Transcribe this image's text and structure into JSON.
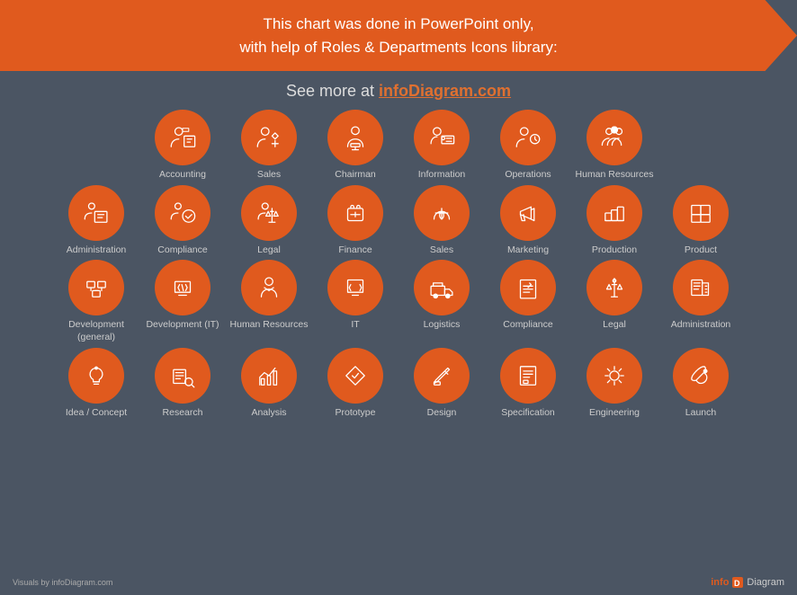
{
  "banner": {
    "line1": "This chart was done in PowerPoint only,",
    "line2": "with help of Roles & Departments Icons library:"
  },
  "see_more": {
    "prefix": "See more at ",
    "link_text": "infoDiagram.com"
  },
  "rows": [
    {
      "items": [
        {
          "label": "Accounting",
          "icon": "accounting"
        },
        {
          "label": "Sales",
          "icon": "sales"
        },
        {
          "label": "Chairman",
          "icon": "chairman"
        },
        {
          "label": "Information",
          "icon": "information"
        },
        {
          "label": "Operations",
          "icon": "operations"
        },
        {
          "label": "Human\nResources",
          "icon": "human_resources"
        }
      ]
    },
    {
      "items": [
        {
          "label": "Administration",
          "icon": "administration"
        },
        {
          "label": "Compliance",
          "icon": "compliance"
        },
        {
          "label": "Legal",
          "icon": "legal"
        },
        {
          "label": "Finance",
          "icon": "finance"
        },
        {
          "label": "Sales",
          "icon": "sales2"
        },
        {
          "label": "Marketing",
          "icon": "marketing"
        },
        {
          "label": "Production",
          "icon": "production"
        },
        {
          "label": "Product",
          "icon": "product"
        }
      ]
    },
    {
      "items": [
        {
          "label": "Development\n(general)",
          "icon": "dev_general"
        },
        {
          "label": "Development\n(IT)",
          "icon": "dev_it"
        },
        {
          "label": "Human\nResources",
          "icon": "human_resources2"
        },
        {
          "label": "IT",
          "icon": "it"
        },
        {
          "label": "Logistics",
          "icon": "logistics"
        },
        {
          "label": "Compliance",
          "icon": "compliance2"
        },
        {
          "label": "Legal",
          "icon": "legal2"
        },
        {
          "label": "Administration",
          "icon": "administration2"
        }
      ]
    },
    {
      "items": [
        {
          "label": "Idea / Concept",
          "icon": "idea"
        },
        {
          "label": "Research",
          "icon": "research"
        },
        {
          "label": "Analysis",
          "icon": "analysis"
        },
        {
          "label": "Prototype",
          "icon": "prototype"
        },
        {
          "label": "Design",
          "icon": "design"
        },
        {
          "label": "Specification",
          "icon": "specification"
        },
        {
          "label": "Engineering",
          "icon": "engineering"
        },
        {
          "label": "Launch",
          "icon": "launch"
        }
      ]
    }
  ],
  "footer": {
    "credit": "Visuals by infoDiagram.com",
    "logo": "info Diagram"
  }
}
